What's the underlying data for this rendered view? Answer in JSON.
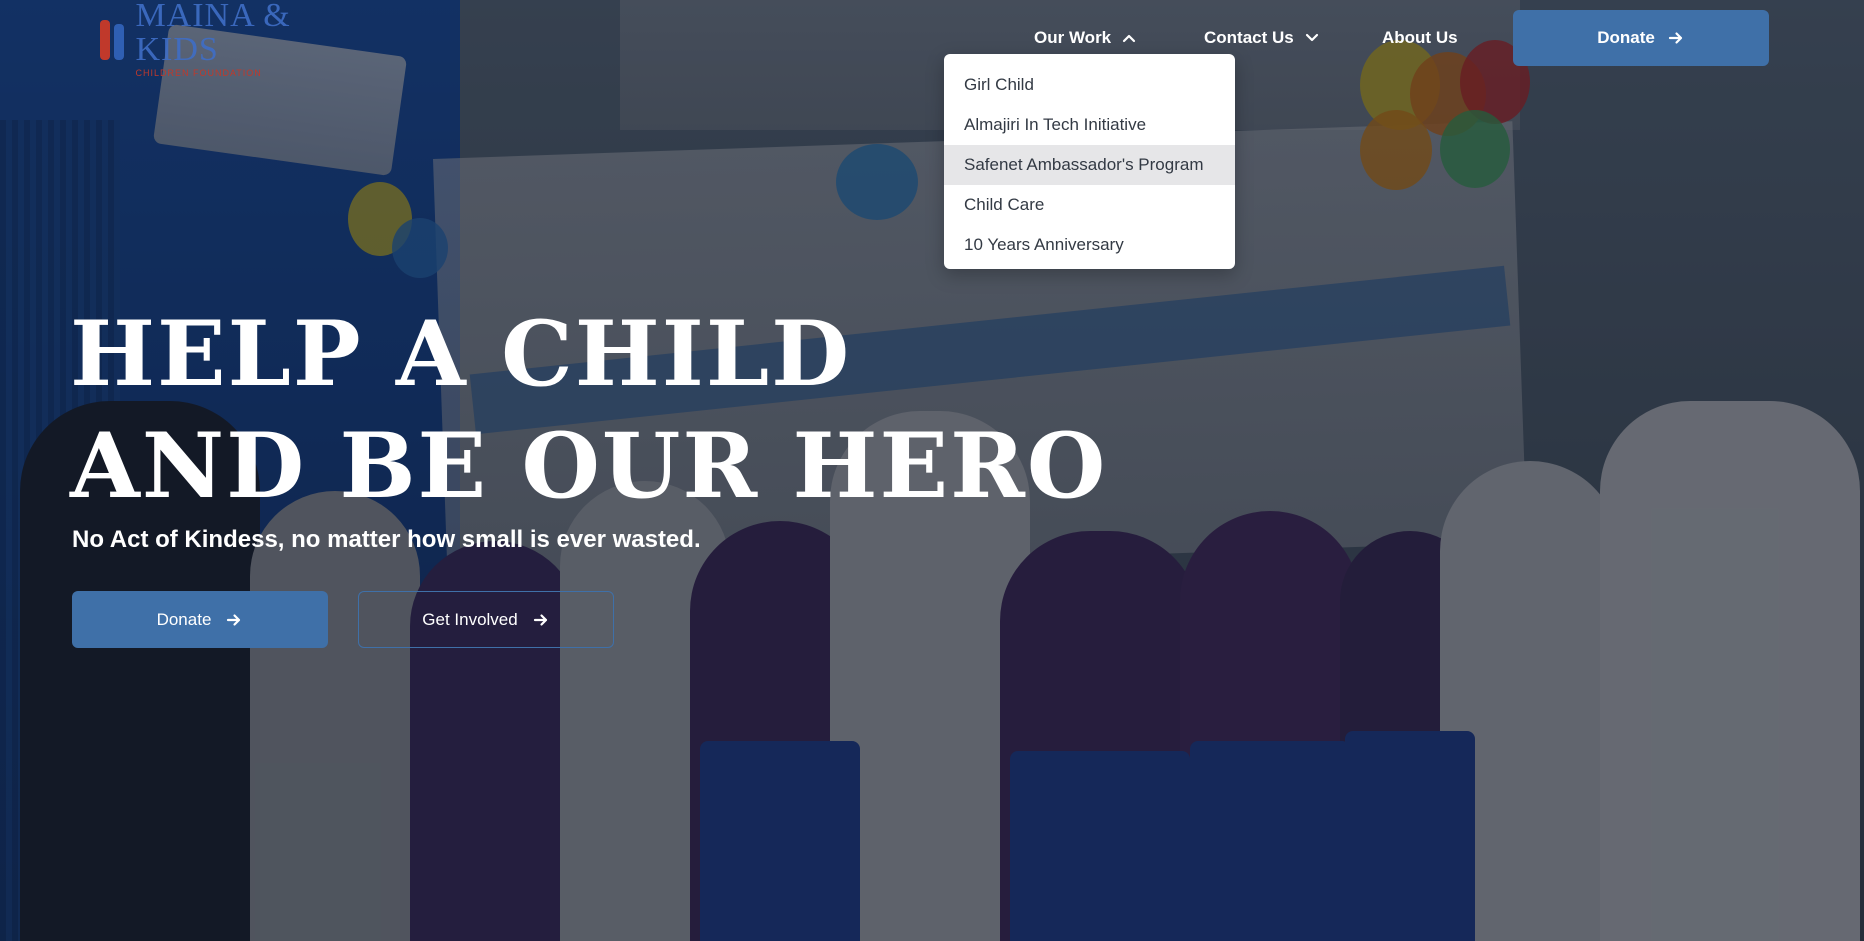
{
  "header": {
    "logo": {
      "name": "MAINA & KIDS",
      "subtitle": "CHILDREN FOUNDATION"
    },
    "nav": [
      {
        "label": "Our Work",
        "icon": "chevron-up-icon",
        "expanded": true
      },
      {
        "label": "Contact Us",
        "icon": "chevron-down-icon",
        "expanded": false
      },
      {
        "label": "About Us"
      }
    ],
    "donate_label": "Donate",
    "donate_icon": "arrow-right-icon"
  },
  "dropdown": {
    "items": [
      {
        "label": "Girl Child"
      },
      {
        "label": "Almajiri In Tech Initiative"
      },
      {
        "label": "Safenet Ambassador's Program",
        "hovered": true
      },
      {
        "label": "Child Care"
      },
      {
        "label": "10 Years Anniversary"
      }
    ]
  },
  "hero": {
    "headline_line1": "HELP A CHILD",
    "headline_line2": "AND BE OUR HERO",
    "tagline": "No Act of Kindess, no matter how small is ever wasted.",
    "primary_button": "Donate",
    "secondary_button": "Get Involved"
  },
  "colors": {
    "accent": "#3f70a8",
    "text": "#ffffff",
    "dropdown_bg": "#ffffff",
    "dropdown_hover": "#e6e6e8"
  }
}
